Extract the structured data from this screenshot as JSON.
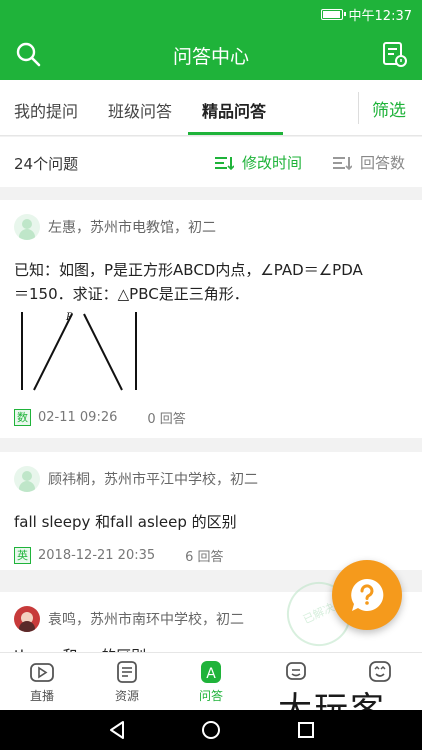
{
  "status_bar": {
    "time": "中午12:37",
    "battery_level": 0.85
  },
  "header": {
    "title": "问答中心",
    "left_icon": "search-icon",
    "right_icon": "document-icon"
  },
  "tabs": [
    {
      "label": "我的提问"
    },
    {
      "label": "班级问答"
    },
    {
      "label": "精品问答",
      "active": true
    }
  ],
  "filter_label": "筛选",
  "sort_row": {
    "count": "24个问题",
    "sort_time": "修改时间",
    "sort_answers": "回答数"
  },
  "questions": [
    {
      "author": "左惠，苏州市电教馆，初二",
      "text_line1": "已知：如图，P是正方形ABCD内点，∠PAD＝∠PDA",
      "text_line2": "＝150．求证：△PBC是正三角形．",
      "diagram_label": "P",
      "subject": "数",
      "date": "02-11 09:26",
      "answers": "0 回答"
    },
    {
      "author": "顾祎桐，苏州市平江中学校，初二",
      "text_line1": "fall sleepy 和fall asleep 的区别",
      "subject": "英",
      "date": "2018-12-21 20:35",
      "answers": "6 回答"
    },
    {
      "author": "袁鸣，苏州市南环中学校，初二",
      "text_line1": "the ... 和 ... 的区别"
    }
  ],
  "fab_icon": "question-icon",
  "stamp_text": "已解决",
  "bottom_nav": [
    {
      "label": "直播",
      "icon": "video-icon"
    },
    {
      "label": "资源",
      "icon": "resource-icon"
    },
    {
      "label": "问答",
      "icon": "qa-icon",
      "active": true
    },
    {
      "label": "",
      "icon": "headset-icon"
    },
    {
      "label": "",
      "icon": "smile-icon"
    }
  ],
  "watermark": "大玩客",
  "colors": {
    "brand": "#1fb33a",
    "fab": "#f59a1c"
  }
}
